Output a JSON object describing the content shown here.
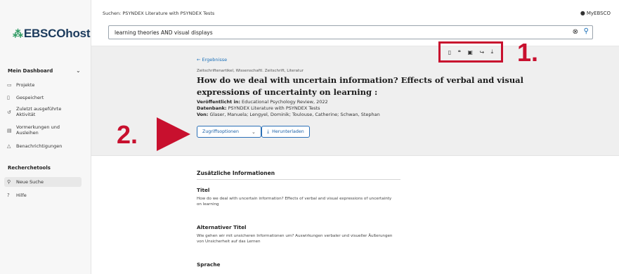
{
  "sidebar": {
    "logo": "EBSCOhost",
    "dashboard_title": "Mein Dashboard",
    "dashboard_items": [
      {
        "label": "Projekte",
        "icon": "folder-icon"
      },
      {
        "label": "Gespeichert",
        "icon": "bookmark-icon"
      },
      {
        "label": "Zuletzt ausgeführte Aktivität",
        "icon": "history-icon"
      },
      {
        "label": "Vormerkungen und Ausleihen",
        "icon": "book-icon"
      },
      {
        "label": "Benachrichtigungen",
        "icon": "bell-icon"
      }
    ],
    "tools_title": "Recherchetools",
    "tools_items": [
      {
        "label": "Neue Suche",
        "icon": "search-icon"
      },
      {
        "label": "Hilfe",
        "icon": "help-icon"
      }
    ]
  },
  "topbar": {
    "search_scope": "Suchen:  PSYNDEX Literature with PSYNDEX Tests",
    "account_label": "MyEBSCO",
    "search_value": "learning theories AND visual displays"
  },
  "record": {
    "back_label": "Ergebnisse",
    "pubtype": "Zeitschriftenartikel, Wissenschaftl. Zeitschrift, Literatur",
    "title": "How do we deal with uncertain information? Effects of verbal and visual expressions of uncertainty on learning :",
    "published_label": "Veröffentlicht in:",
    "published_value": "Educational Psychology Review, 2022",
    "database_label": "Datenbank:",
    "database_value": "PSYNDEX Literature with PSYNDEX Tests",
    "authors_label": "Von:",
    "authors_value": "Glaser, Manuela; Lengyel, Dominik; Toulouse, Catherine; Schwan, Stephan",
    "access_button": "Zugriffsoptionen",
    "download_button": "Herunterladen"
  },
  "annotations": {
    "marker1": "1.",
    "marker2": "2."
  },
  "details": {
    "heading": "Zusätzliche Informationen",
    "title_label": "Titel",
    "title_text": "How do we deal with uncertain information? Effects of verbal and visual expressions of uncertainty on learning",
    "alt_title_label": "Alternativer Titel",
    "alt_title_text": "Wie gehen wir mit unsicheren Informationen um? Auswirkungen verbaler und visueller Äußerungen von Unsicherheit auf das Lernen",
    "language_label": "Sprache"
  },
  "colors": {
    "annotation_red": "#c8102e",
    "link_blue": "#1a6fb8",
    "logo_navy": "#1b3a5c",
    "logo_green": "#2f9a63"
  }
}
